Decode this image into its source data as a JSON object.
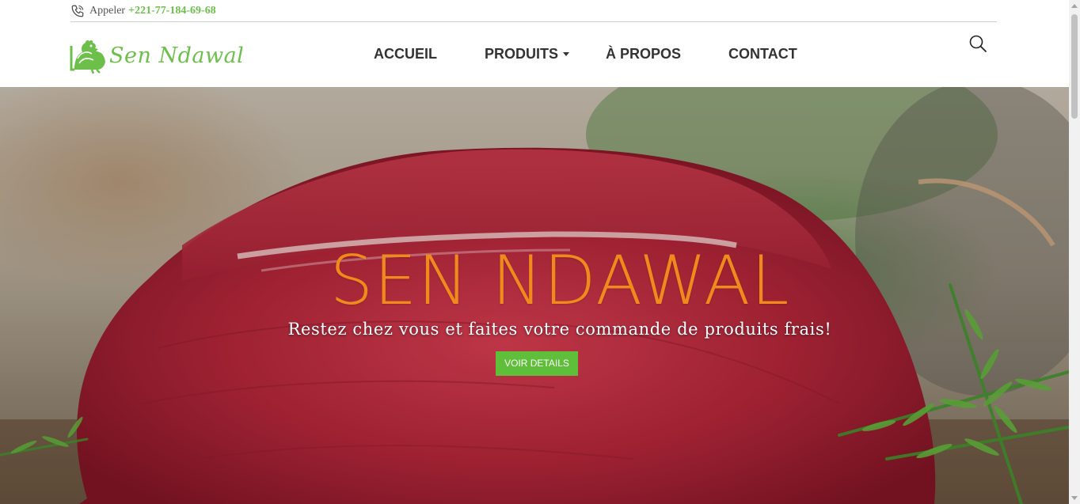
{
  "topbar": {
    "call_label": "Appeler",
    "call_number": "+221-77-184-69-68",
    "icon": "phone-icon"
  },
  "header": {
    "logo_text": "Sen Ndawal",
    "logo_icon": "rooster-logo-icon",
    "nav": [
      {
        "label": "ACCUEIL"
      },
      {
        "label": "PRODUITS"
      },
      {
        "label": "À PROPOS"
      },
      {
        "label": "CONTACT"
      }
    ],
    "search_icon": "search-icon"
  },
  "hero": {
    "title": "SEN NDAWAL",
    "subtitle": "Restez chez vous et faites votre commande de produits frais!",
    "button_label": "VOIR DETAILS",
    "background_image": "raw-beef-with-rosemary"
  },
  "colors": {
    "brand_green": "#6cc04a",
    "button_green": "#5fbe3a",
    "title_orange": "#f18a1c",
    "nav_text": "#333333"
  }
}
